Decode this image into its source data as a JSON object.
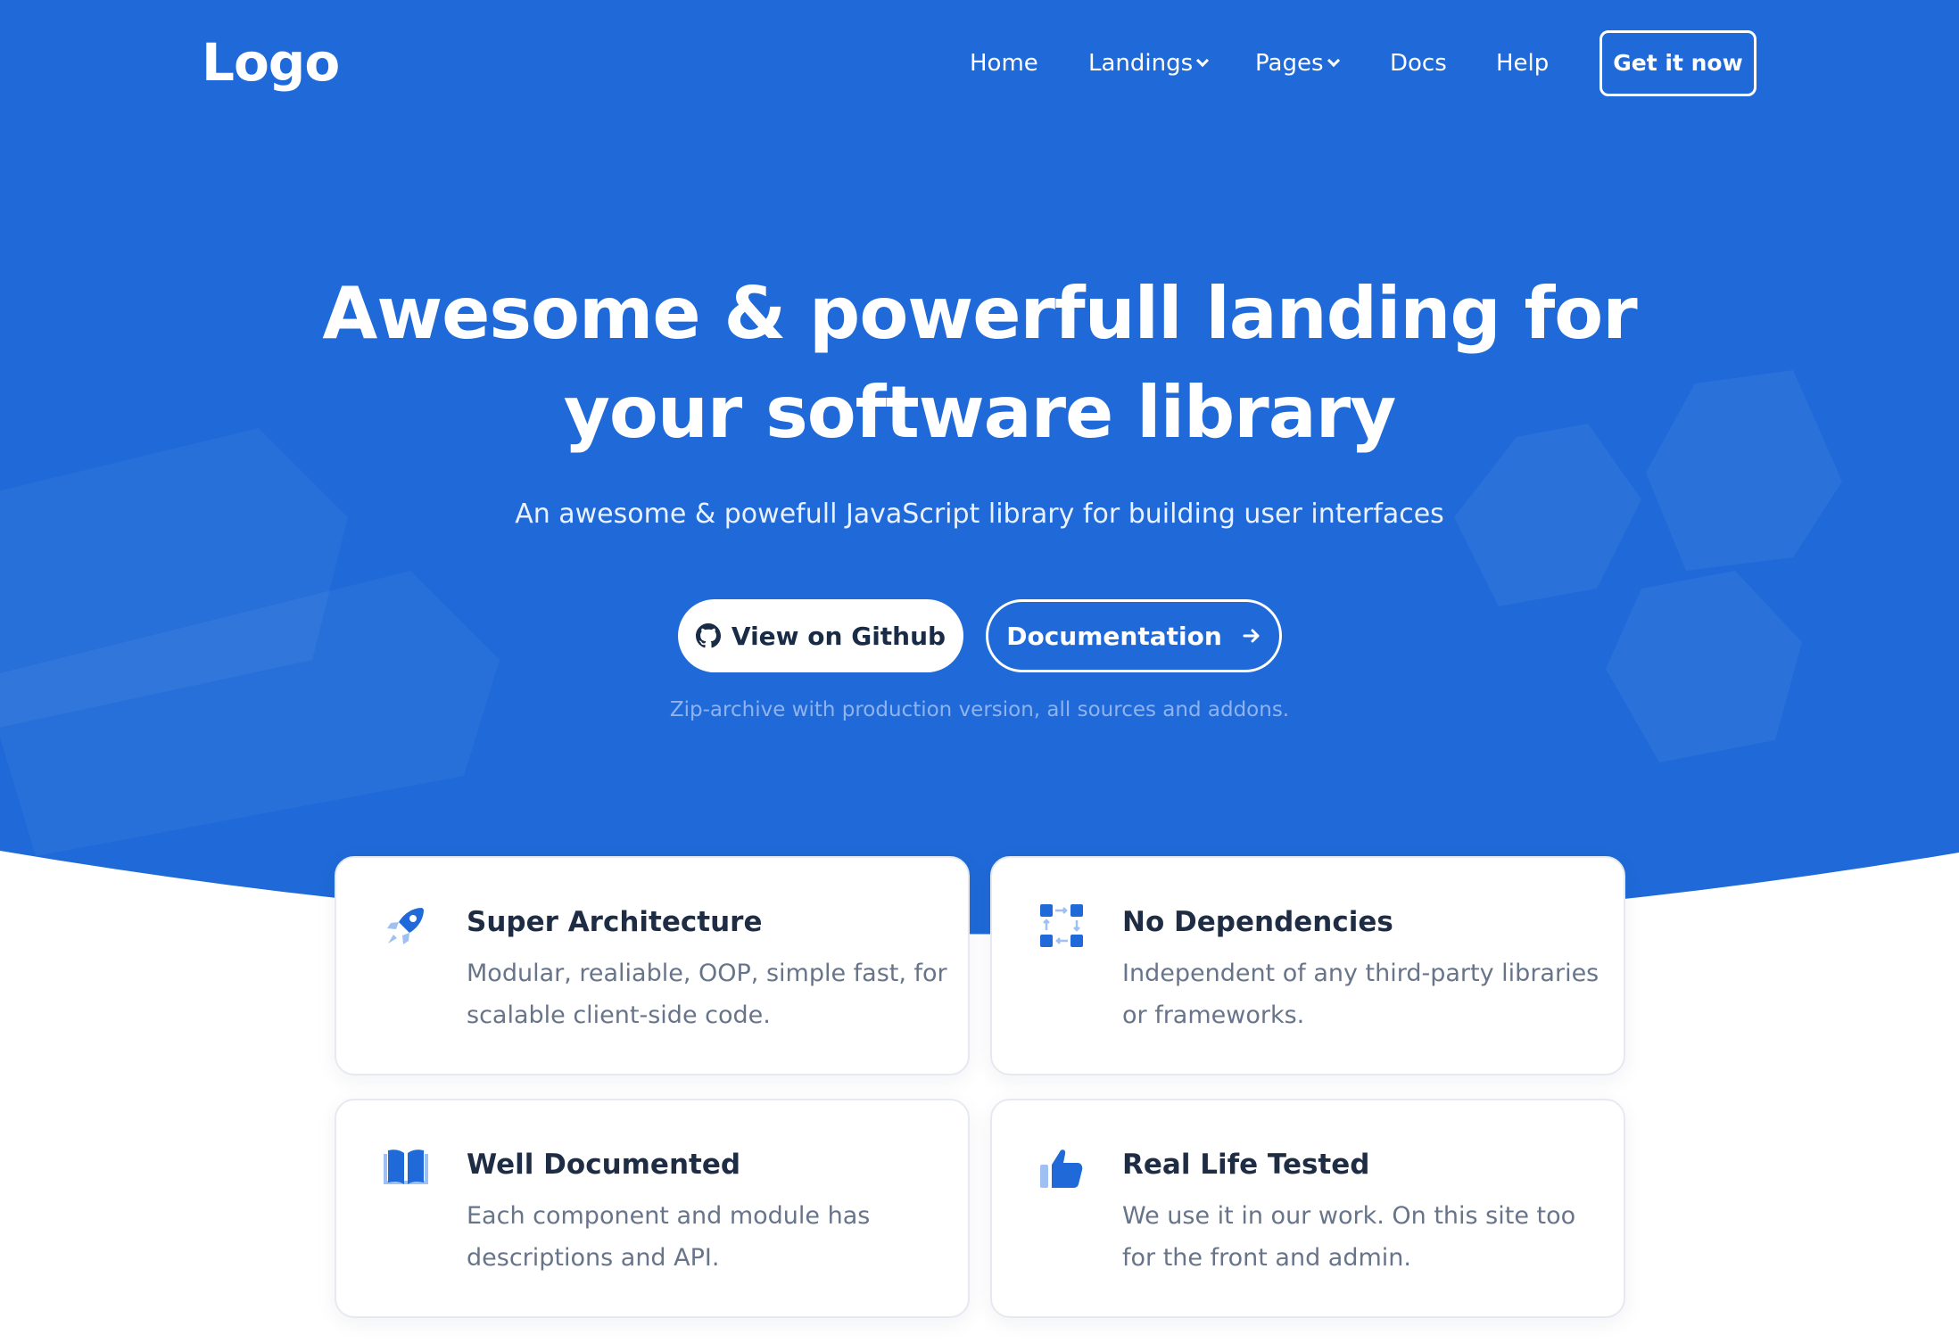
{
  "colors": {
    "brand_blue": "#1f6ad8",
    "white": "#ffffff",
    "text_dark": "#1f2d44",
    "text_muted": "#677489",
    "icon_blue": "#1f6ad8",
    "icon_light": "#9fc0f2"
  },
  "header": {
    "logo": "Logo",
    "nav": [
      {
        "label": "Home",
        "has_dropdown": false
      },
      {
        "label": "Landings",
        "has_dropdown": true
      },
      {
        "label": "Pages",
        "has_dropdown": true
      },
      {
        "label": "Docs",
        "has_dropdown": false
      },
      {
        "label": "Help",
        "has_dropdown": false
      }
    ],
    "cta_label": "Get it now"
  },
  "hero": {
    "headline_line1": "Awesome & powerfull landing for",
    "headline_line2": "your software library",
    "subtitle": "An awesome & powefull JavaScript library for building user interfaces",
    "github_button": {
      "label": "View on Github",
      "icon": "github-icon"
    },
    "docs_button": {
      "label": "Documentation",
      "icon": "arrow-right-icon"
    },
    "note": "Zip-archive with production version, all sources and addons."
  },
  "features": [
    {
      "icon": "rocket-icon",
      "title": "Super Architecture",
      "desc_line1": "Modular, realiable, OOP, simple fast, for",
      "desc_line2": "scalable client-side code."
    },
    {
      "icon": "modules-icon",
      "title": "No Dependencies",
      "desc_line1": "Independent of any third-party libraries",
      "desc_line2": "or frameworks."
    },
    {
      "icon": "book-icon",
      "title": "Well Documented",
      "desc_line1": "Each component and module has",
      "desc_line2": "descriptions and API."
    },
    {
      "icon": "thumbs-up-icon",
      "title": "Real Life Tested",
      "desc_line1": "We use it in our work. On this site too",
      "desc_line2": "for the front and admin."
    }
  ]
}
